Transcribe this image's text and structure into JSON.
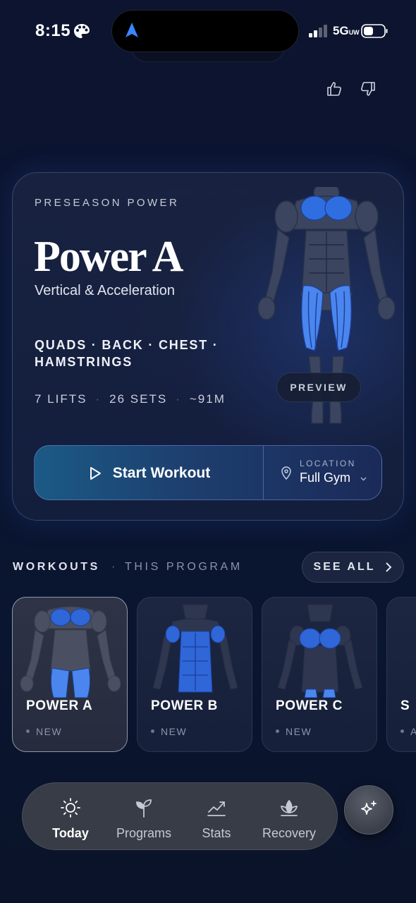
{
  "status_bar": {
    "time": "8:15",
    "network": "5G",
    "network_sub": "UW"
  },
  "hero": {
    "eyebrow": "PRESEASON POWER",
    "title": "Power A",
    "subtitle": "Vertical & Acceleration",
    "muscles_line1": "QUADS · BACK · CHEST ·",
    "muscles_line2": "HAMSTRINGS",
    "stats": [
      "7 LIFTS",
      "26 SETS",
      "~91M"
    ],
    "stats_separator": "·",
    "preview_label": "PREVIEW",
    "start_label": "Start Workout",
    "location_eyebrow": "LOCATION",
    "location_value": "Full Gym",
    "accent_color": "#3f78e0"
  },
  "workouts_section": {
    "title": "WORKOUTS",
    "dot": "·",
    "subtitle": "THIS PROGRAM",
    "see_all_label": "SEE ALL"
  },
  "workouts": [
    {
      "name": "POWER A",
      "badge": "NEW",
      "selected": true
    },
    {
      "name": "POWER B",
      "badge": "NEW",
      "selected": false
    },
    {
      "name": "POWER C",
      "badge": "NEW",
      "selected": false
    },
    {
      "name": "S",
      "badge": "A",
      "selected": false
    }
  ],
  "tabbar": {
    "items": [
      {
        "label": "Today",
        "icon": "sun-icon",
        "active": true
      },
      {
        "label": "Programs",
        "icon": "sprout-icon",
        "active": false
      },
      {
        "label": "Stats",
        "icon": "line-chart-icon",
        "active": false
      },
      {
        "label": "Recovery",
        "icon": "lotus-icon",
        "active": false
      }
    ],
    "ai_button_icon": "sparkle-icon"
  }
}
